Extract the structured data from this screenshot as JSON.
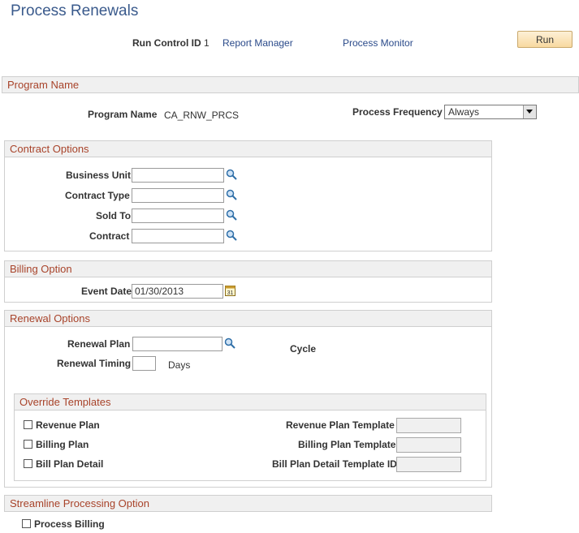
{
  "page": {
    "title": "Process Renewals"
  },
  "run_control": {
    "label": "Run Control ID",
    "value": "1",
    "report_manager": "Report Manager",
    "process_monitor": "Process Monitor",
    "run_button": "Run"
  },
  "program_name_section": {
    "header": "Program Name",
    "program_name_label": "Program Name",
    "program_name_value": "CA_RNW_PRCS",
    "frequency_label": "Process Frequency",
    "frequency_value": "Always"
  },
  "contract_options": {
    "header": "Contract Options",
    "business_unit_label": "Business Unit",
    "contract_type_label": "Contract Type",
    "sold_to_label": "Sold To",
    "contract_label": "Contract"
  },
  "billing_option": {
    "header": "Billing Option",
    "event_date_label": "Event Date",
    "event_date_value": "01/30/2013"
  },
  "renewal_options": {
    "header": "Renewal Options",
    "renewal_plan_label": "Renewal Plan",
    "cycle_label": "Cycle",
    "renewal_timing_label": "Renewal Timing",
    "days_label": "Days"
  },
  "override_templates": {
    "header": "Override Templates",
    "revenue_plan_label": "Revenue Plan",
    "billing_plan_label": "Billing Plan",
    "bill_plan_detail_label": "Bill Plan Detail",
    "revenue_plan_template_label": "Revenue Plan Template",
    "billing_plan_template_label": "Billing Plan Template",
    "bill_plan_detail_template_label": "Bill Plan Detail Template ID"
  },
  "streamline": {
    "header": "Streamline Processing Option",
    "process_billing_label": "Process Billing"
  },
  "colors": {
    "title": "#3a5a8c",
    "section_header_text": "#a8432a",
    "section_header_bg": "#f0f0f0",
    "link": "#2a4a8a",
    "run_button_bg": "#f8d9a0"
  }
}
